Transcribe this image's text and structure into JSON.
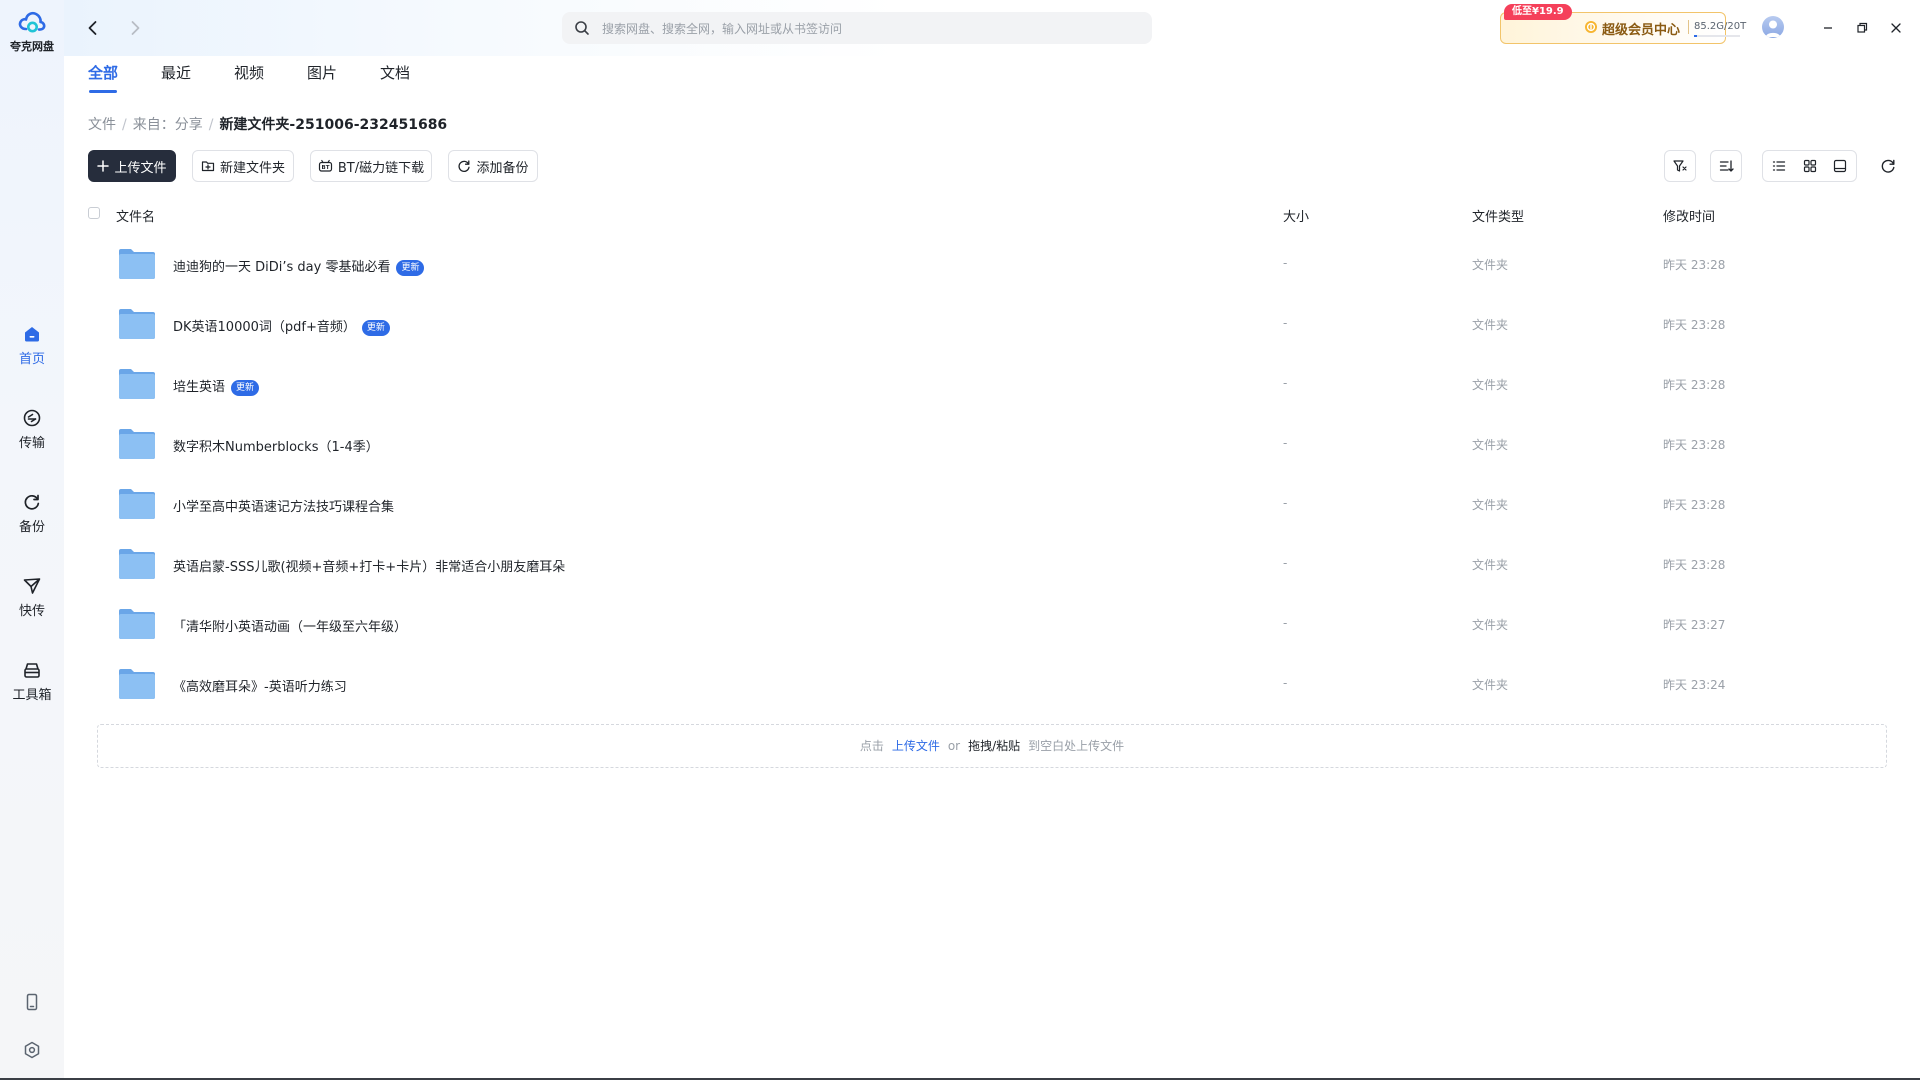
{
  "app": {
    "name": "夸克网盘"
  },
  "sidebar": {
    "items": [
      {
        "label": "首页",
        "icon": "home-icon"
      },
      {
        "label": "传输",
        "icon": "transfer-icon"
      },
      {
        "label": "备份",
        "icon": "backup-icon"
      },
      {
        "label": "快传",
        "icon": "quick-send-icon"
      },
      {
        "label": "工具箱",
        "icon": "toolbox-icon"
      }
    ],
    "bottom_icons": [
      "phone-icon",
      "settings-icon"
    ]
  },
  "header": {
    "search_placeholder": "搜索网盘、搜索全网，输入网址或从书签访问",
    "promo_tag": "低至¥19.9",
    "vip_label": "超级会员中心",
    "storage": {
      "text": "85.2G/20T",
      "used_fraction": 0.004
    }
  },
  "tabs": [
    {
      "label": "全部",
      "active": true
    },
    {
      "label": "最近",
      "active": false
    },
    {
      "label": "视频",
      "active": false
    },
    {
      "label": "图片",
      "active": false
    },
    {
      "label": "文档",
      "active": false
    }
  ],
  "breadcrumb": {
    "items": [
      "文件",
      "来自：分享"
    ],
    "current": "新建文件夹-251006-232451686"
  },
  "toolbar": {
    "upload": "上传文件",
    "new_folder": "新建文件夹",
    "bt_download": "BT/磁力链下载",
    "add_backup": "添加备份"
  },
  "columns": {
    "name": "文件名",
    "size": "大小",
    "type": "文件类型",
    "modified": "修改时间"
  },
  "files": [
    {
      "name": "迪迪狗的一天 DiDi’s day 零基础必看",
      "badge": "更新",
      "size": "-",
      "type": "文件夹",
      "modified": "昨天 23:28"
    },
    {
      "name": "DK英语10000词（pdf+音频）",
      "badge": "更新",
      "size": "-",
      "type": "文件夹",
      "modified": "昨天 23:28"
    },
    {
      "name": "培生英语",
      "badge": "更新",
      "size": "-",
      "type": "文件夹",
      "modified": "昨天 23:28"
    },
    {
      "name": "数字积木Numberblocks（1-4季）",
      "badge": "",
      "size": "-",
      "type": "文件夹",
      "modified": "昨天 23:28"
    },
    {
      "name": "小学至高中英语速记方法技巧课程合集",
      "badge": "",
      "size": "-",
      "type": "文件夹",
      "modified": "昨天 23:28"
    },
    {
      "name": "英语启蒙-SSS儿歌(视频+音频+打卡+卡片）非常适合小朋友磨耳朵",
      "badge": "",
      "size": "-",
      "type": "文件夹",
      "modified": "昨天 23:28"
    },
    {
      "name": "「清华附小英语动画（一年级至六年级）",
      "badge": "",
      "size": "-",
      "type": "文件夹",
      "modified": "昨天 23:27"
    },
    {
      "name": "《高效磨耳朵》-英语听力练习",
      "badge": "",
      "size": "-",
      "type": "文件夹",
      "modified": "昨天 23:24"
    }
  ],
  "drop_zone": {
    "prefix": "点击",
    "upload_link": "上传文件",
    "or": "or",
    "drag": "拖拽/粘贴",
    "suffix": "到空白处上传文件"
  },
  "colors": {
    "accent": "#2e6be6",
    "primary_button": "#262d3c",
    "folder": "#7fb6f0",
    "promo": "#f5405a"
  }
}
